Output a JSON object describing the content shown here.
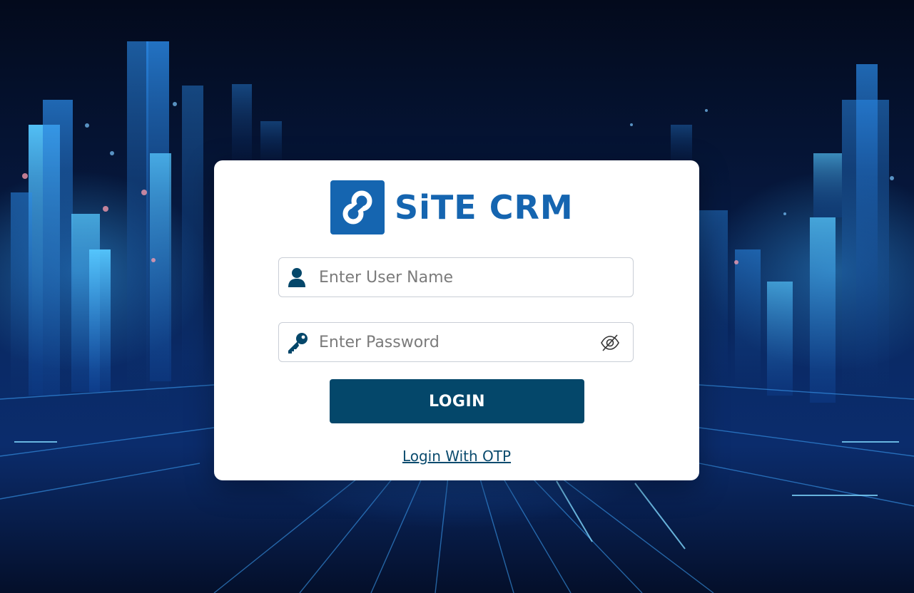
{
  "brand": {
    "name": "SiTE CRM",
    "color": "#1565b0",
    "logo_icon": "chain-link-logo-icon"
  },
  "login_form": {
    "username": {
      "placeholder": "Enter User Name",
      "value": "",
      "icon": "user-icon"
    },
    "password": {
      "placeholder": "Enter Password",
      "value": "",
      "icon": "key-icon",
      "toggle_icon": "eye-slash-icon"
    },
    "login_button_label": "LOGIN",
    "otp_link_label": "Login With OTP",
    "button_color": "#04476a"
  },
  "background": {
    "theme": "blue digital cityscape"
  }
}
